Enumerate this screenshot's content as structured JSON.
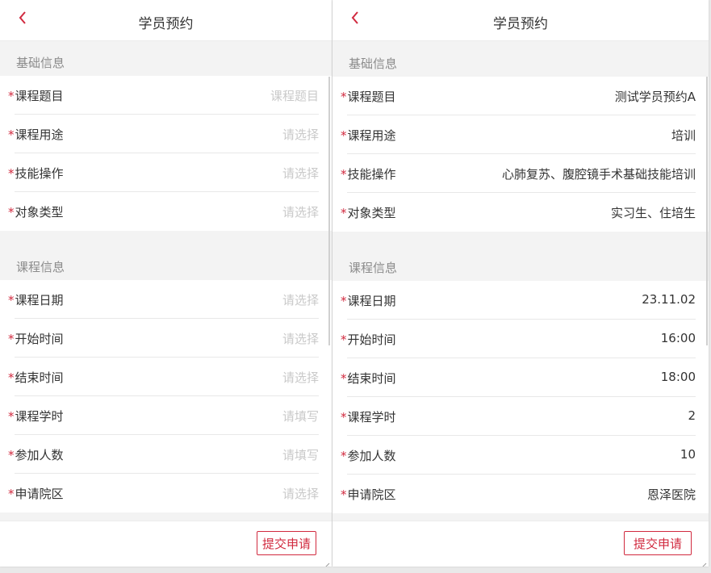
{
  "left": {
    "header": {
      "back_icon": "chevron-left-icon",
      "title": "学员预约"
    },
    "section_basic": "基础信息",
    "section_course": "课程信息",
    "required_mark": "*",
    "rows": [
      {
        "label": "课程题目",
        "value": "课程题目"
      },
      {
        "label": "课程用途",
        "value": "请选择"
      },
      {
        "label": "技能操作",
        "value": "请选择"
      },
      {
        "label": "对象类型",
        "value": "请选择"
      },
      {
        "label": "课程日期",
        "value": "请选择"
      },
      {
        "label": "开始时间",
        "value": "请选择"
      },
      {
        "label": "结束时间",
        "value": "请选择"
      },
      {
        "label": "课程学时",
        "value": "请填写"
      },
      {
        "label": "参加人数",
        "value": "请填写"
      },
      {
        "label": "申请院区",
        "value": "请选择"
      }
    ],
    "submit_label": "提交申请"
  },
  "right": {
    "header": {
      "back_icon": "chevron-left-icon",
      "title": "学员预约"
    },
    "section_basic": "基础信息",
    "section_course": "课程信息",
    "required_mark": "*",
    "rows": [
      {
        "label": "课程题目",
        "value": "测试学员预约A"
      },
      {
        "label": "课程用途",
        "value": "培训"
      },
      {
        "label": "技能操作",
        "value": "心肺复苏、腹腔镜手术基础技能培训"
      },
      {
        "label": "对象类型",
        "value": "实习生、住培生"
      },
      {
        "label": "课程日期",
        "value": "23.11.02"
      },
      {
        "label": "开始时间",
        "value": "16:00"
      },
      {
        "label": "结束时间",
        "value": "18:00"
      },
      {
        "label": "课程学时",
        "value": "2"
      },
      {
        "label": "参加人数",
        "value": "10"
      },
      {
        "label": "申请院区",
        "value": "恩泽医院"
      }
    ],
    "submit_label": "提交申请"
  },
  "colors": {
    "accent": "#d12a3f",
    "placeholder": "#c9c9c9",
    "section_bg": "#f3f3f3"
  }
}
